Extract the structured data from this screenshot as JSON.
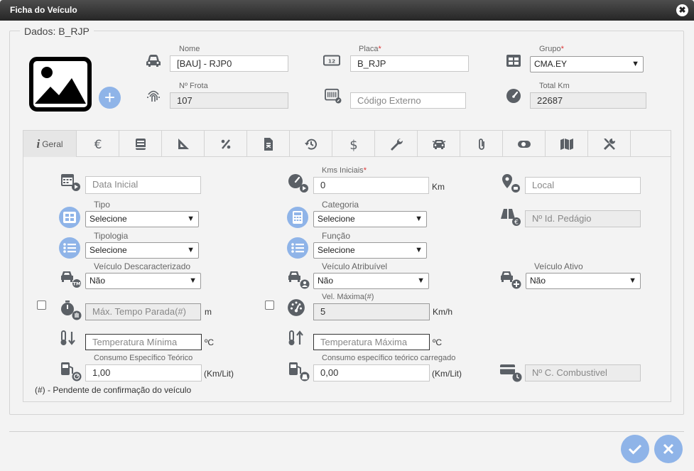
{
  "window": {
    "title": "Ficha do Veículo",
    "close_symbol": "✖"
  },
  "legend": "Dados: B_RJP",
  "header": {
    "nome_label": "Nome",
    "nome_value": "[BAU] - RJP0",
    "placa_label": "Placa",
    "placa_value": "B_RJP",
    "grupo_label": "Grupo",
    "grupo_value": "CMA.EY",
    "frota_label": "Nº Frota",
    "frota_value": "107",
    "codigo_placeholder": "Código Externo",
    "totalkm_label": "Total Km",
    "totalkm_value": "22687",
    "required_mark": "*"
  },
  "tabs": {
    "first_label": "Geral",
    "icons": [
      "euro-icon",
      "book-icon",
      "ruler-icon",
      "percent-icon",
      "document-icon",
      "history-icon",
      "dollar-icon",
      "wrench-icon",
      "car-front-icon",
      "paperclip-icon",
      "toggle-icon",
      "map-icon",
      "tools-icon"
    ]
  },
  "geral": {
    "data_inicial_placeholder": "Data Inicial",
    "kms_label": "Kms Iniciais",
    "kms_value": "0",
    "kms_unit": "Km",
    "local_placeholder": "Local",
    "tipo_label": "Tipo",
    "tipo_value": "Selecione",
    "categoria_label": "Categoria",
    "categoria_value": "Selecione",
    "pedagio_placeholder": "Nº Id. Pedágio",
    "tipologia_label": "Tipologia",
    "tipologia_value": "Selecione",
    "funcao_label": "Função",
    "funcao_value": "Selecione",
    "descaracterizado_label": "Veículo Descaracterizado",
    "descaracterizado_value": "Não",
    "atribuivel_label": "Veículo Atribuível",
    "atribuivel_value": "Não",
    "ativo_label": "Veículo Ativo",
    "ativo_value": "Não",
    "tempo_parada_placeholder": "Máx. Tempo Parada(#)",
    "tempo_parada_unit": "m",
    "vel_label": "Vel. Máxima(#)",
    "vel_value": "5",
    "vel_unit": "Km/h",
    "temp_min_placeholder": "Temperatura Mínima",
    "temp_min_unit": "ºC",
    "temp_max_placeholder": "Temperatura Máxima",
    "temp_max_unit": "ºC",
    "consumo_label": "Consumo Específico Teórico",
    "consumo_value": "1,00",
    "consumo_unit": "(Km/Lit)",
    "consumo_carr_label": "Consumo específico teórico carregado",
    "consumo_carr_value": "0,00",
    "consumo_carr_unit": "(Km/Lit)",
    "combustivel_placeholder": "Nº C. Combustivel",
    "note": "(#) - Pendente de confirmação do veículo"
  },
  "colors": {
    "accent": "#8fb4e8",
    "icon": "#5b6066",
    "title_bar": "#333333"
  }
}
